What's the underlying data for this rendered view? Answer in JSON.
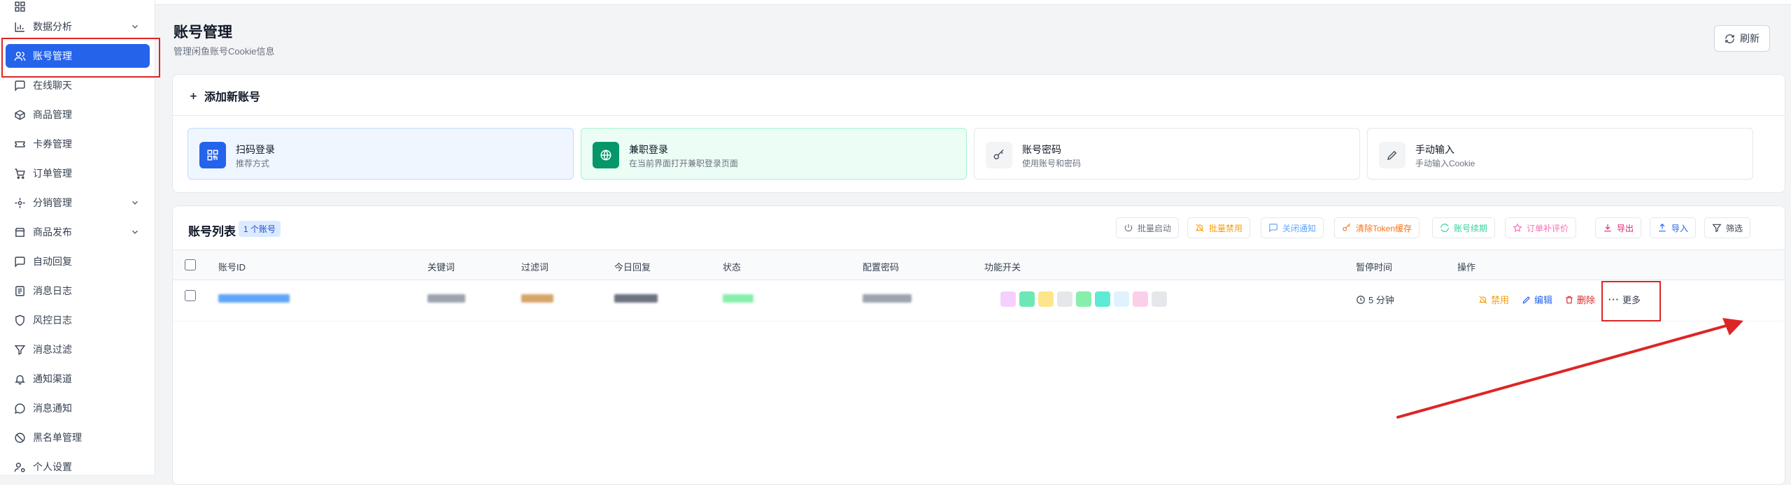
{
  "sidebar": {
    "items": [
      {
        "label": "数据分析",
        "icon": "bar-chart-icon",
        "chevron": true
      },
      {
        "label": "账号管理",
        "icon": "users-icon",
        "active": true
      },
      {
        "label": "在线聊天",
        "icon": "chat-bubble-icon"
      },
      {
        "label": "商品管理",
        "icon": "package-icon"
      },
      {
        "label": "卡券管理",
        "icon": "ticket-icon"
      },
      {
        "label": "订单管理",
        "icon": "cart-icon"
      },
      {
        "label": "分销管理",
        "icon": "network-icon",
        "chevron": true
      },
      {
        "label": "商品发布",
        "icon": "store-icon",
        "chevron": true
      },
      {
        "label": "自动回复",
        "icon": "chat-bubble-icon"
      },
      {
        "label": "消息日志",
        "icon": "log-icon"
      },
      {
        "label": "风控日志",
        "icon": "shield-icon"
      },
      {
        "label": "消息过滤",
        "icon": "filter-icon"
      },
      {
        "label": "通知渠道",
        "icon": "bell-icon"
      },
      {
        "label": "消息通知",
        "icon": "message-circle-icon"
      },
      {
        "label": "黑名单管理",
        "icon": "ban-icon"
      },
      {
        "label": "个人设置",
        "icon": "user-settings-icon"
      }
    ]
  },
  "header": {
    "title": "账号管理",
    "subtitle": "管理闲鱼账号Cookie信息",
    "refresh_label": "刷新"
  },
  "add_account": {
    "title": "添加新账号",
    "options": [
      {
        "title": "扫码登录",
        "desc": "推荐方式",
        "icon": "qr-code-icon",
        "color": "#2563eb"
      },
      {
        "title": "兼职登录",
        "desc": "在当前界面打开兼职登录页面",
        "icon": "globe-icon",
        "color": "#16a34a"
      },
      {
        "title": "账号密码",
        "desc": "使用账号和密码",
        "icon": "key-icon",
        "color": "#6b7280"
      },
      {
        "title": "手动输入",
        "desc": "手动输入Cookie",
        "icon": "pencil-icon",
        "color": "#6b7280"
      }
    ]
  },
  "account_list": {
    "title": "账号列表",
    "count_badge": "1 个账号",
    "toolbar": {
      "batch_enable": "批量启动",
      "batch_disable": "批量禁用",
      "close_notify": "关闭通知",
      "clear_token": "清除Token缓存",
      "renew": "账号续期",
      "order_review": "订单补评价",
      "export": "导出",
      "import": "导入",
      "filter": "筛选"
    },
    "columns": [
      "账号ID",
      "关键词",
      "过滤词",
      "今日回复",
      "状态",
      "配置密码",
      "功能开关",
      "暂停时间",
      "操作"
    ],
    "rows": [
      {
        "pause_time": "5 分钟",
        "actions": {
          "disable": "禁用",
          "edit": "编辑",
          "delete": "删除",
          "more": "更多"
        }
      }
    ]
  },
  "colors": {
    "primary": "#2563eb",
    "danger": "#dc2626",
    "success": "#16a34a",
    "warning": "#f59e0b"
  }
}
